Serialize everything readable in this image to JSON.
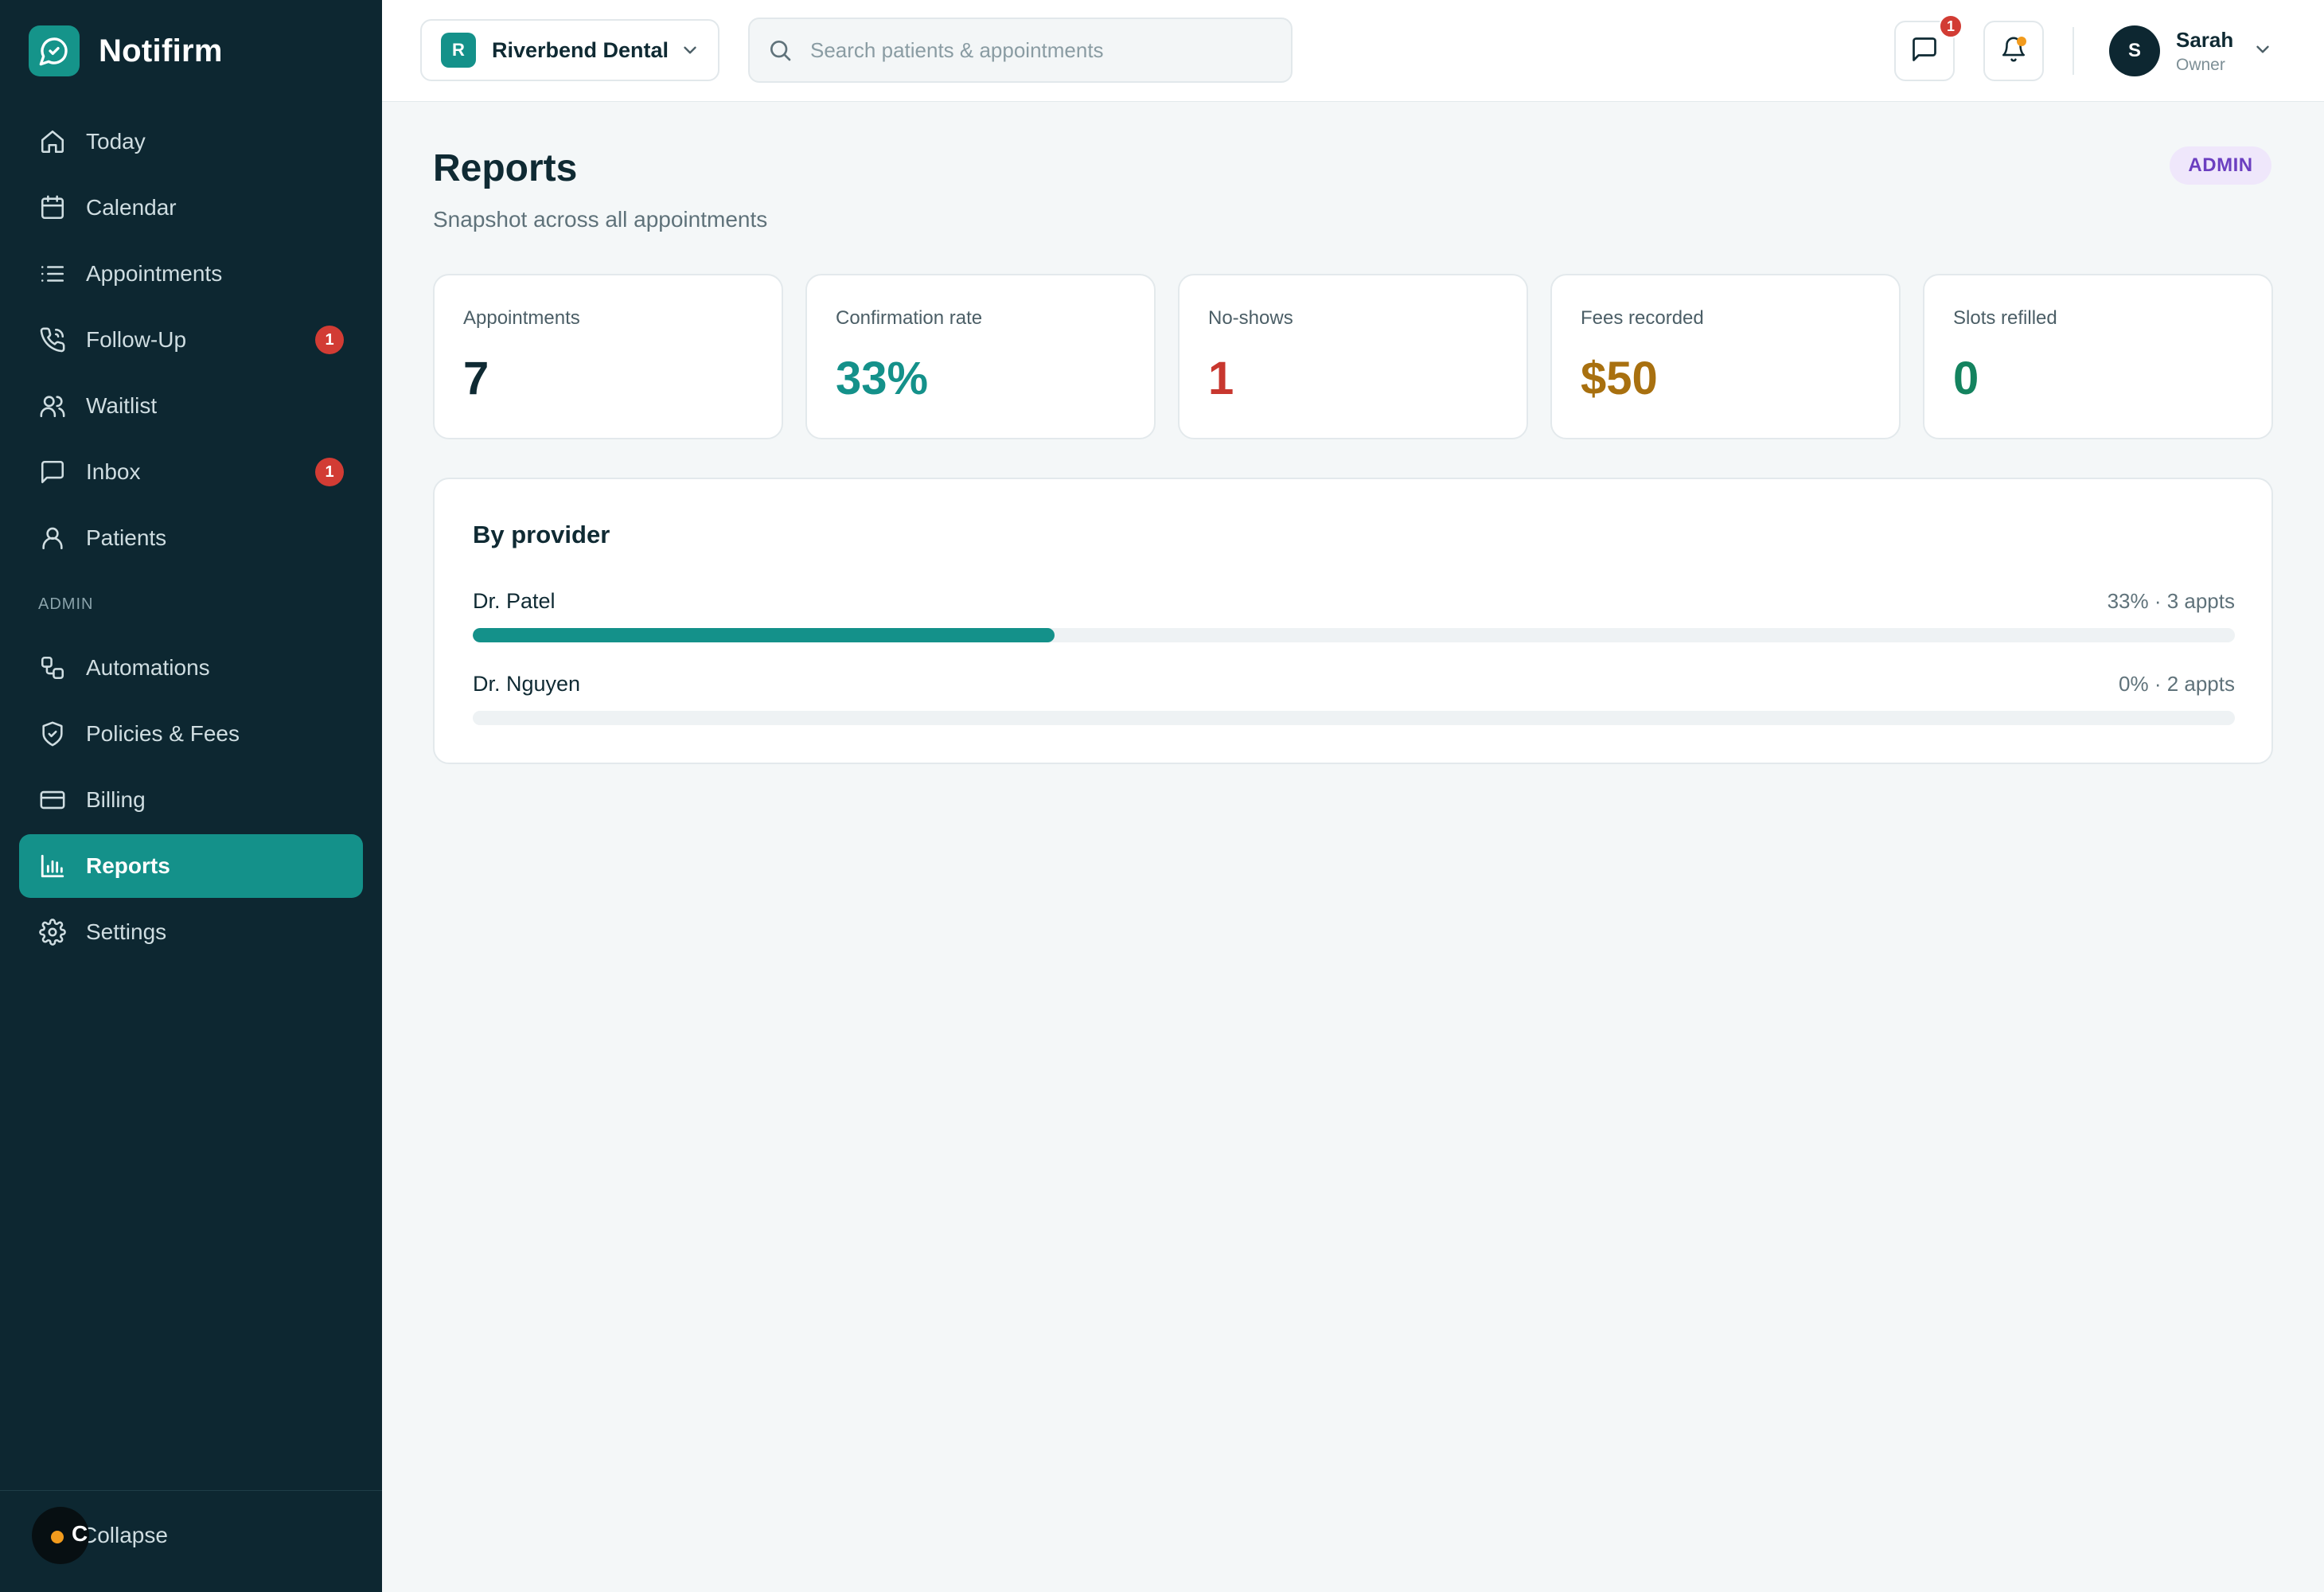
{
  "brand": {
    "name": "Notifirm"
  },
  "sidebar": {
    "items": [
      {
        "label": "Today",
        "icon": "home-icon"
      },
      {
        "label": "Calendar",
        "icon": "calendar-icon"
      },
      {
        "label": "Appointments",
        "icon": "list-icon"
      },
      {
        "label": "Follow-Up",
        "icon": "phone-icon",
        "badge": "1"
      },
      {
        "label": "Waitlist",
        "icon": "users-icon"
      },
      {
        "label": "Inbox",
        "icon": "message-icon",
        "badge": "1"
      },
      {
        "label": "Patients",
        "icon": "user-icon"
      }
    ],
    "admin_section_label": "ADMIN",
    "admin_items": [
      {
        "label": "Automations",
        "icon": "workflow-icon"
      },
      {
        "label": "Policies & Fees",
        "icon": "shield-icon"
      },
      {
        "label": "Billing",
        "icon": "credit-card-icon"
      },
      {
        "label": "Reports",
        "icon": "bar-chart-icon",
        "active": true
      },
      {
        "label": "Settings",
        "icon": "gear-icon"
      }
    ],
    "collapse_label": "Collapse",
    "collapse_avatar_letter": "C"
  },
  "topbar": {
    "practice_initial": "R",
    "practice_name": "Riverbend Dental",
    "search_placeholder": "Search patients & appointments",
    "messages_badge": "1",
    "user_initial": "S",
    "user_name": "Sarah",
    "user_role": "Owner"
  },
  "page": {
    "title": "Reports",
    "subtitle": "Snapshot across all appointments",
    "admin_badge": "ADMIN"
  },
  "stats": [
    {
      "label": "Appointments",
      "value": "7",
      "color": "#0f2a33"
    },
    {
      "label": "Confirmation rate",
      "value": "33%",
      "color": "#14918a"
    },
    {
      "label": "No-shows",
      "value": "1",
      "color": "#c8372f"
    },
    {
      "label": "Fees recorded",
      "value": "$50",
      "color": "#a8700f"
    },
    {
      "label": "Slots refilled",
      "value": "0",
      "color": "#14835f"
    }
  ],
  "providers": {
    "title": "By provider",
    "rows": [
      {
        "name": "Dr. Patel",
        "meta": "33% · 3 appts",
        "rate": 0.33
      },
      {
        "name": "Dr. Nguyen",
        "meta": "0% · 2 appts",
        "rate": 0
      }
    ]
  },
  "colors": {
    "accent": "#14918a",
    "sidebar_bg": "#0d2731",
    "badge_red": "#d23c34"
  }
}
